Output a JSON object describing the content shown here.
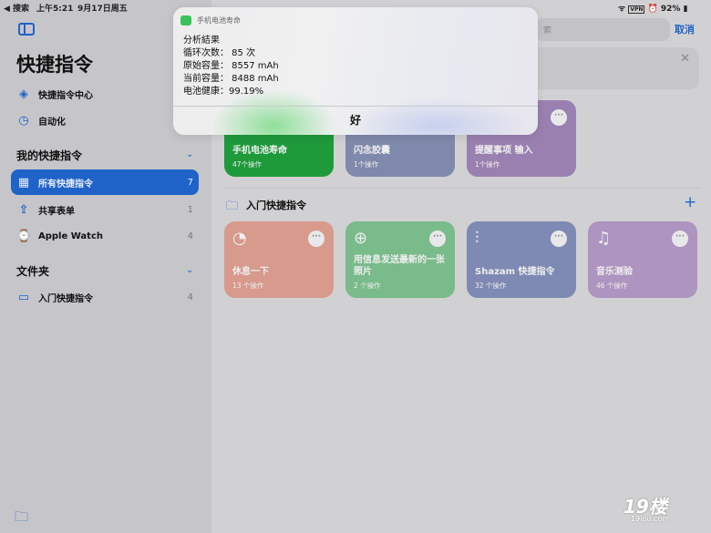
{
  "status_bar": {
    "back": "◀ 搜索",
    "time": "上午5:21",
    "date": "9月17日周五",
    "battery": "92%",
    "vpn": "VPN"
  },
  "sidebar": {
    "title": "快捷指令",
    "top_items": [
      {
        "label": "快捷指令中心",
        "icon": "layers-icon"
      },
      {
        "label": "自动化",
        "icon": "clock-check-icon"
      }
    ],
    "my_section": "我的快捷指令",
    "my_items": [
      {
        "label": "所有快捷指令",
        "count": "7",
        "icon": "grid-icon",
        "selected": true
      },
      {
        "label": "共享表单",
        "count": "1",
        "icon": "share-icon"
      },
      {
        "label": "Apple Watch",
        "count": "4",
        "icon": "watch-icon"
      }
    ],
    "folders_section": "文件夹",
    "folder_items": [
      {
        "label": "入门快捷指令",
        "count": "4",
        "icon": "folder-icon"
      }
    ]
  },
  "main": {
    "search_partial": "索",
    "cancel": "取消",
    "row1": [
      {
        "title": "手机电池寿命",
        "sub": "47个操作",
        "color": "#1e9a3b"
      },
      {
        "title": "闪念胶囊",
        "sub": "1个操作",
        "color": "#7f89ab"
      },
      {
        "title": "提醒事项 输入",
        "sub": "1个操作",
        "color": "#9a80b0"
      }
    ],
    "folder_title": "入门快捷指令",
    "row2": [
      {
        "title": "休息一下",
        "sub": "13 个操作",
        "color": "#d79a8c",
        "icon": "timer-icon"
      },
      {
        "title": "用信息发送最新的一张照片",
        "sub": "2 个操作",
        "color": "#79bb8a",
        "icon": "message-plus-icon"
      },
      {
        "title": "Shazam 快捷指令",
        "sub": "32 个操作",
        "color": "#7e8ab3",
        "icon": "waveform-icon"
      },
      {
        "title": "音乐测验",
        "sub": "46 个操作",
        "color": "#ae94c0",
        "icon": "music-list-icon"
      }
    ]
  },
  "alert": {
    "app": "手机电池寿命",
    "heading": "分析結果",
    "lines": [
      "循环次数： 85 次",
      "原始容量： 8557 mAh",
      "当前容量： 8488 mAh",
      "电池健康：99.19%"
    ],
    "ok": "好"
  },
  "watermark": {
    "brand": "19楼",
    "url": "19lou.com"
  }
}
